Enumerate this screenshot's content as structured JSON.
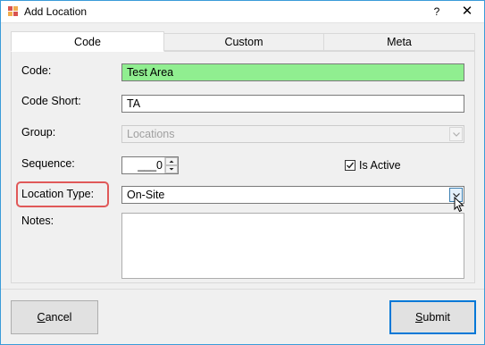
{
  "window": {
    "title": "Add Location",
    "help_label": "?",
    "close_label": "✕"
  },
  "tabs": [
    {
      "label": "Code",
      "active": true
    },
    {
      "label": "Custom",
      "active": false
    },
    {
      "label": "Meta",
      "active": false
    }
  ],
  "form": {
    "code": {
      "label": "Code:",
      "value": "Test Area"
    },
    "code_short": {
      "label": "Code Short:",
      "value": "TA"
    },
    "group": {
      "label": "Group:",
      "value": "Locations"
    },
    "sequence": {
      "label": "Sequence:",
      "value": "___0"
    },
    "is_active": {
      "label": "Is Active",
      "checked": true
    },
    "location_type": {
      "label": "Location Type:",
      "value": "On-Site"
    },
    "notes": {
      "label": "Notes:",
      "value": ""
    }
  },
  "buttons": {
    "cancel": {
      "prefix": "",
      "mnemonic": "C",
      "rest": "ancel"
    },
    "submit": {
      "prefix": "",
      "mnemonic": "S",
      "rest": "ubmit"
    }
  },
  "colors": {
    "code_field_bg": "#90ee90",
    "highlight": "#e05858",
    "default_button_border": "#0078d7",
    "window_border": "#3a9bd9"
  },
  "icons": {
    "app": "app-icon",
    "checkbox": "checkmark-icon",
    "dropdown": "chevron-down-icon",
    "cursor": "mouse-cursor-icon"
  }
}
